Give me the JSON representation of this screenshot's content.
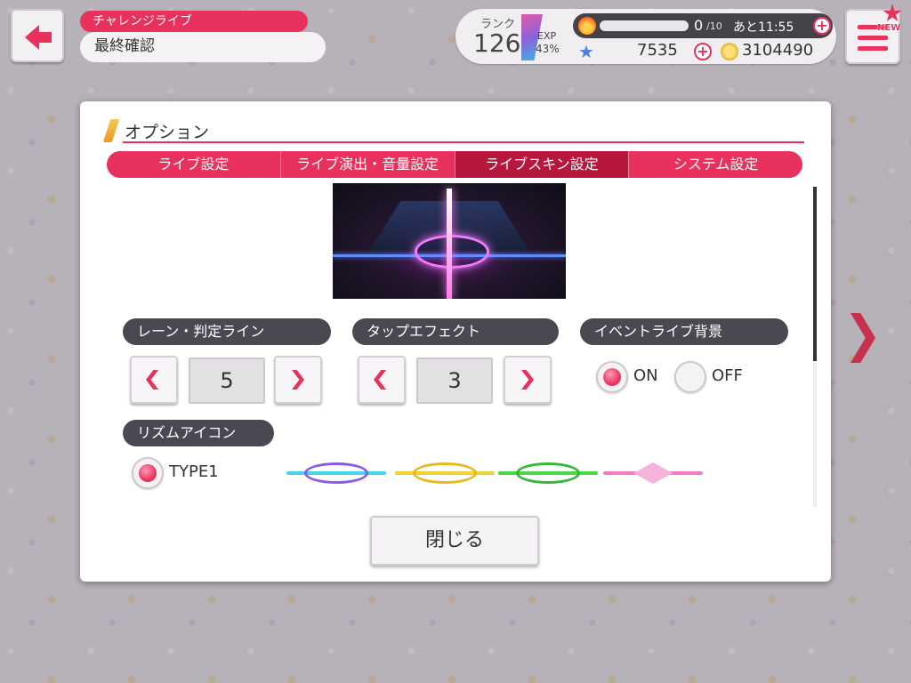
{
  "header": {
    "stage_tag": "チャレンジライブ",
    "stage_title": "最終確認",
    "rank_label": "ランク",
    "rank_value": "126",
    "exp_label": "EXP",
    "exp_percent": "43%",
    "stamina_value": "0",
    "stamina_max": "/10",
    "stamina_timer": "あと11:55",
    "star_count": "7535",
    "coin_count": "3104490",
    "new_badge": "NEW"
  },
  "modal": {
    "title": "オプション",
    "tabs": [
      {
        "label": "ライブ設定",
        "active": false
      },
      {
        "label": "ライブ演出・音量設定",
        "active": false
      },
      {
        "label": "ライブスキン設定",
        "active": true
      },
      {
        "label": "システム設定",
        "active": false
      }
    ],
    "lane": {
      "label": "レーン・判定ライン",
      "value": "5"
    },
    "tap_effect": {
      "label": "タップエフェクト",
      "value": "3"
    },
    "event_bg": {
      "label": "イベントライブ背景",
      "on_label": "ON",
      "off_label": "OFF",
      "selected": "ON"
    },
    "rhythm_icon": {
      "label": "リズムアイコン",
      "type_label": "TYPE1"
    },
    "close_label": "閉じる"
  },
  "colors": {
    "accent": "#e8315c",
    "accent_dark": "#b8173d",
    "label_bg": "#4a4850"
  }
}
